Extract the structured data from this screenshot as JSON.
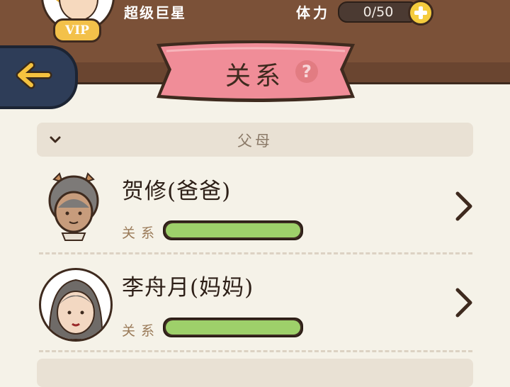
{
  "header": {
    "username": "超级巨星",
    "vip_label": "VIP",
    "stamina_label": "体力",
    "stamina_value": "0/50"
  },
  "title": {
    "text": "关系",
    "help": "?"
  },
  "sections": [
    {
      "label": "父母"
    }
  ],
  "members": [
    {
      "name": "贺修(爸爸)",
      "relation_label": "关系",
      "relation_level": 1.0
    },
    {
      "name": "李舟月(妈妈)",
      "relation_label": "关系",
      "relation_level": 1.0
    }
  ],
  "colors": {
    "top_bar": "#7b5138",
    "banner": "#f08d98",
    "bar_fill": "#9ed06a",
    "back_button": "#2e3d58",
    "back_arrow": "#f5c23f"
  }
}
